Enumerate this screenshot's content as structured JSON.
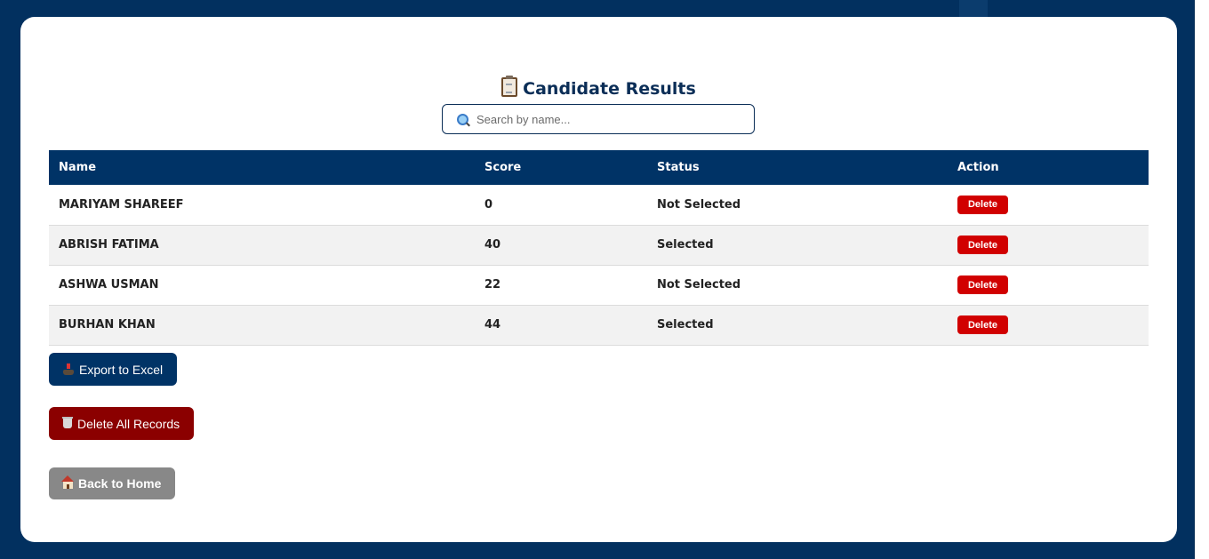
{
  "page": {
    "title": "Candidate Results"
  },
  "search": {
    "placeholder": "Search by name..."
  },
  "table": {
    "headers": {
      "name": "Name",
      "score": "Score",
      "status": "Status",
      "action": "Action"
    },
    "rows": [
      {
        "name": "MARIYAM SHAREEF",
        "score": "0",
        "status": "Not Selected",
        "action": "Delete"
      },
      {
        "name": "ABRISH FATIMA",
        "score": "40",
        "status": "Selected",
        "action": "Delete"
      },
      {
        "name": "ASHWA USMAN",
        "score": "22",
        "status": "Not Selected",
        "action": "Delete"
      },
      {
        "name": "BURHAN KHAN",
        "score": "44",
        "status": "Selected",
        "action": "Delete"
      }
    ]
  },
  "buttons": {
    "export": "Export to Excel",
    "delete_all": "Delete All Records",
    "home": "Back to Home"
  },
  "icons": {
    "title": "clipboard-icon",
    "search": "magnifier-icon",
    "export": "export-icon",
    "delete_all": "trash-icon",
    "home": "house-icon"
  },
  "colors": {
    "background": "#003366",
    "header": "#003366",
    "delete": "#d10000",
    "delete_all": "#8b0000",
    "home": "#888888"
  }
}
